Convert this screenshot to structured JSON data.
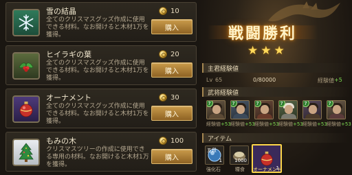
{
  "shop": {
    "items": [
      {
        "name": "雪の結晶",
        "desc": "全てのクリスマスグッズ作成に使用できる材料。なお開けると木材1万を獲得。",
        "price": "10",
        "buy_label": "購入",
        "icon": "snowflake-icon"
      },
      {
        "name": "ヒイラギの葉",
        "desc": "全てのクリスマスグッズ作成に使用できる材料。なお開けると木材1万を獲得。",
        "price": "20",
        "buy_label": "購入",
        "icon": "holly-icon"
      },
      {
        "name": "オーナメント",
        "desc": "全てのクリスマスグッズ作成に使用できる材料。なお開けると木材1万を獲得。",
        "price": "30",
        "buy_label": "購入",
        "icon": "ornament-icon"
      },
      {
        "name": "もみの木",
        "desc": "クリスマスツリーの作成に使用できる専用の材料。なお開けると木材1万を獲得。",
        "price": "100",
        "buy_label": "購入",
        "icon": "fir-tree-icon"
      }
    ]
  },
  "result": {
    "banner": "戦闘勝利",
    "stars": 3,
    "lord_section": "主君経験値",
    "lord_level_label": "Lv",
    "lord_level": "65",
    "lord_exp": "0/80000",
    "lord_exp_label": "経験値",
    "lord_exp_gain": "+5",
    "general_section": "武将経験値",
    "generals": [
      {
        "level": "7",
        "exp_label": "経験値",
        "exp_gain": "+53"
      },
      {
        "level": "7",
        "exp_label": "経験値",
        "exp_gain": "+53"
      },
      {
        "level": "7",
        "exp_label": "経験値",
        "exp_gain": "+53"
      },
      {
        "level": "7",
        "exp_label": "経験値",
        "exp_gain": "+53"
      },
      {
        "level": "7",
        "exp_label": "経験値",
        "exp_gain": "+53"
      },
      {
        "level": "7",
        "exp_label": "経験値",
        "exp_gain": "+53"
      }
    ],
    "item_section": "アイテム",
    "items": [
      {
        "name": "強化石",
        "count": "1",
        "tag": "五段"
      },
      {
        "name": "糧食",
        "count": "1000",
        "tag": ""
      },
      {
        "name": "オーナメント",
        "count": "1",
        "tag": ""
      }
    ]
  }
}
